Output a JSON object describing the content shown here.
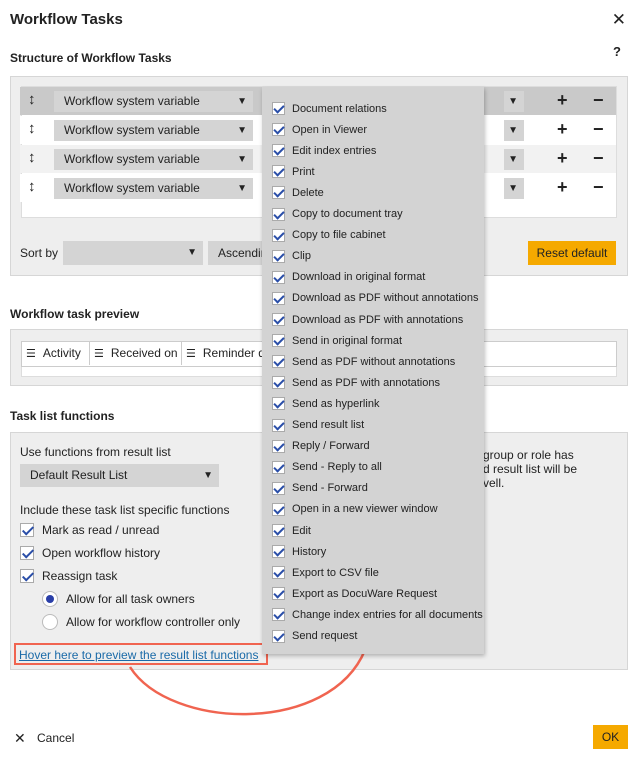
{
  "dialog": {
    "title": "Workflow Tasks",
    "cancel_label": "Cancel",
    "ok_label": "OK"
  },
  "structure": {
    "heading": "Structure of Workflow Tasks",
    "help": "?",
    "rows": [
      {
        "field": "Workflow system variable"
      },
      {
        "field": "Workflow system variable"
      },
      {
        "field": "Workflow system variable"
      },
      {
        "field": "Workflow system variable"
      }
    ],
    "sort_label": "Sort by",
    "sort_value": "",
    "order_value": "Ascending",
    "reset_label": "Reset default"
  },
  "preview": {
    "heading": "Workflow task preview",
    "columns": [
      "Activity",
      "Received on",
      "Reminder date"
    ]
  },
  "functions": {
    "heading": "Task list functions",
    "use_label": "Use functions from result list",
    "result_list_value": "Default Result List",
    "info_text_1": "group or role has",
    "info_text_2": "d result list will be",
    "info_text_3": "vell.",
    "include_label": "Include these task list specific functions",
    "checks": [
      {
        "label": "Mark as read / unread"
      },
      {
        "label": "Open workflow history"
      },
      {
        "label": "Reassign task"
      }
    ],
    "radios": [
      {
        "label": "Allow for all task owners",
        "selected": true
      },
      {
        "label": "Allow for workflow controller only",
        "selected": false
      }
    ],
    "hover_link": "Hover here to preview the result list functions"
  },
  "result_list_functions": [
    "Document relations",
    "Open in Viewer",
    "Edit index entries",
    "Print",
    "Delete",
    "Copy to document tray",
    "Copy to file cabinet",
    "Clip",
    "Download in original format",
    "Download as PDF without annotations",
    "Download as PDF with annotations",
    "Send in original format",
    "Send as PDF without annotations",
    "Send as PDF with annotations",
    "Send as hyperlink",
    "Send result list",
    "Reply / Forward",
    "Send - Reply to all",
    "Send - Forward",
    "Open in a new viewer window",
    "Edit",
    "History",
    "Export to CSV file",
    "Export as DocuWare Request",
    "Change index entries for all documents",
    "Send request"
  ],
  "colors": {
    "accent": "#f5a900",
    "link": "#1a6aa8",
    "check": "#2a4ea8",
    "annotation_arrow": "#f06450"
  }
}
